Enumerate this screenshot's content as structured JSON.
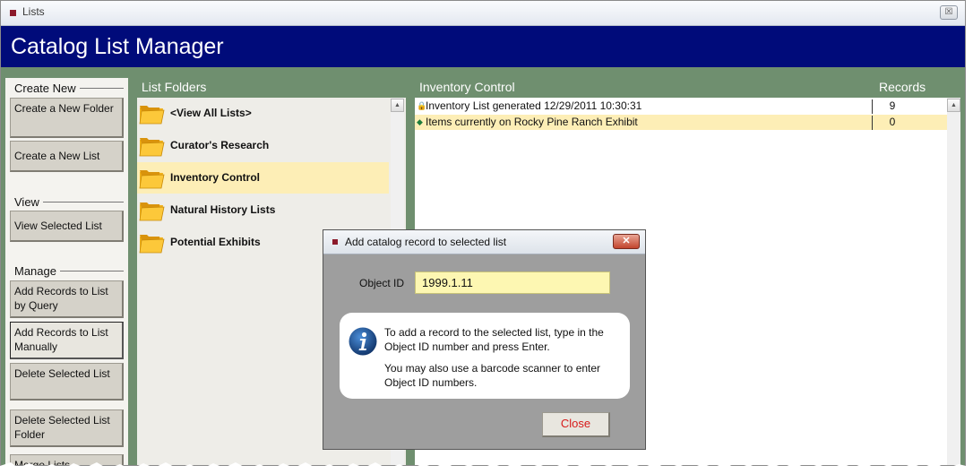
{
  "window": {
    "title": "Lists",
    "close_glyph": "☒"
  },
  "header": {
    "title": "Catalog List Manager"
  },
  "sidebar": {
    "create_new": {
      "heading": "Create New",
      "buttons": [
        {
          "label": "Create a New Folder"
        },
        {
          "label": "Create a New List"
        }
      ]
    },
    "view": {
      "heading": "View",
      "buttons": [
        {
          "label": "View Selected List"
        }
      ]
    },
    "manage": {
      "heading": "Manage",
      "buttons": [
        {
          "label": "Add Records to List by Query"
        },
        {
          "label": "Add Records to List Manually"
        },
        {
          "label": "Delete Selected List"
        },
        {
          "label": "Delete Selected List Folder"
        },
        {
          "label": "Merge Lists"
        }
      ]
    }
  },
  "folders": {
    "heading": "List Folders",
    "selected": "Inventory Control",
    "items": [
      {
        "label": "<View All Lists>"
      },
      {
        "label": "Curator's Research"
      },
      {
        "label": "Inventory Control"
      },
      {
        "label": "Natural History Lists"
      },
      {
        "label": "Potential Exhibits"
      }
    ]
  },
  "records": {
    "heading": "Inventory Control",
    "count_heading": "Records",
    "rows": [
      {
        "icon": "lock-icon",
        "glyph": "🔒",
        "name": "Inventory List generated 12/29/2011 10:30:31",
        "count": "9"
      },
      {
        "icon": "diamond-icon",
        "glyph": "◆",
        "name": "Items currently on Rocky Pine Ranch Exhibit",
        "count": "0"
      }
    ]
  },
  "dialog": {
    "title": "Add catalog record to selected list",
    "close_glyph": "✕",
    "object_id_label": "Object ID",
    "object_id_value": "1999.1.11",
    "info_text_1": "To add a record to the selected list, type in the Object ID number and press Enter.",
    "info_text_2": "You may also use a barcode scanner to enter Object ID numbers.",
    "close_label": "Close"
  },
  "colors": {
    "header_bg": "#000b7a",
    "frame_bg": "#6f8f6f",
    "selection": "#fdeeb6",
    "input_bg": "#fdf7b2",
    "close_text": "#d71a1a"
  }
}
